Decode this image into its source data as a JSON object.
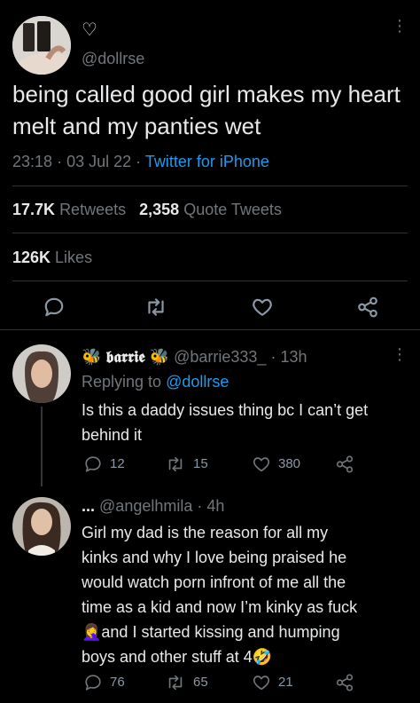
{
  "main_tweet": {
    "verified_symbol": "♡",
    "handle": "@dollrse",
    "text": "being called good girl makes my heart melt and my panties wet",
    "time": "23:18",
    "date": "03 Jul 22",
    "separator": "·",
    "source": "Twitter for iPhone",
    "retweets_count": "17.7K",
    "retweets_label": "Retweets",
    "quotes_count": "2,358",
    "quotes_label": "Quote Tweets",
    "likes_count": "126K",
    "likes_label": "Likes"
  },
  "replies": [
    {
      "display_name": "𝖇𝖆𝖗𝖗𝖎𝖊",
      "name_emoji": "🐝",
      "handle": "@barrie333_",
      "time": "13h",
      "replying_prefix": "Replying to",
      "replying_handle": "@dollrse",
      "text": "Is this a daddy issues thing bc I can’t get behind it",
      "replies": "12",
      "retweets": "15",
      "likes": "380"
    },
    {
      "display_name": "...",
      "handle": "@angelhmila",
      "time": "4h",
      "text_lines": [
        "Girl my dad is the reason for all my",
        "kinks and why I love being praised he",
        "would watch porn infront of me all the",
        "time as a kid and now I’m kinky as fuck",
        "🤦‍♀️and I started kissing and humping",
        "boys and other stuff at 4🤣"
      ],
      "replies": "76",
      "retweets": "65",
      "likes": "21"
    }
  ],
  "colors": {
    "background": "#000000",
    "text": "#e7e9ea",
    "muted": "#71767b",
    "link": "#1d9bf0",
    "divider": "#2f3336"
  }
}
